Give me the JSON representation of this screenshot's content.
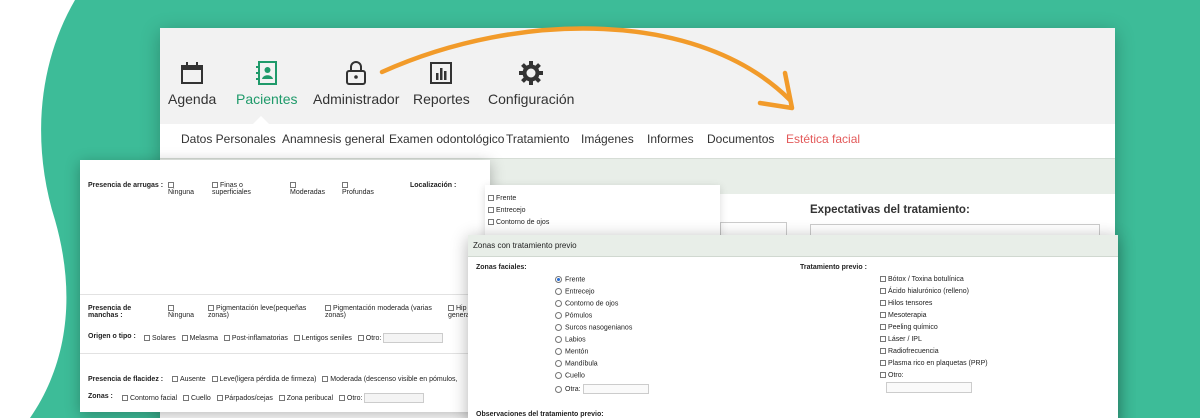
{
  "colors": {
    "background": "#3dbc98",
    "active_nav": "#1f9a6a",
    "active_tab": "#e35a5a",
    "arrow": "#f29b2a"
  },
  "nav": {
    "items": [
      {
        "label": "Agenda",
        "icon": "calendar-icon"
      },
      {
        "label": "Pacientes",
        "icon": "patients-book-icon",
        "active": true
      },
      {
        "label": "Administrador",
        "icon": "lock-icon"
      },
      {
        "label": "Reportes",
        "icon": "bar-chart-icon"
      },
      {
        "label": "Configuración",
        "icon": "gear-icon"
      }
    ]
  },
  "subtabs": [
    "Datos Personales",
    "Anamnesis general",
    "Examen odontológico",
    "Tratamiento",
    "Imágenes",
    "Informes",
    "Documentos",
    "Estética facial"
  ],
  "expectativas": {
    "title": "Expectativas del tratamiento:"
  },
  "arrugas": {
    "label": "Presencia de arrugas :",
    "options": [
      "Ninguna",
      "Finas o superficiales",
      "Moderadas",
      "Profundas"
    ],
    "localizacion_label": "Localización :"
  },
  "localizacion_list": [
    "Frente",
    "Entrecejo",
    "Contorno de ojos"
  ],
  "manchas": {
    "label": "Presencia de manchas :",
    "options": [
      "Ninguna",
      "Pigmentación leve(pequeñas zonas)",
      "Pigmentación moderada (varias zonas)",
      "Hip genera"
    ],
    "origen_label": "Origen o tipo :",
    "origen_options": [
      "Solares",
      "Melasma",
      "Post-inflamatorias",
      "Lentigos seniles",
      "Otro:"
    ]
  },
  "flacidez": {
    "label": "Presencia de flacidez :",
    "options": [
      "Ausente",
      "Leve(ligera pérdida de firmeza)",
      "Moderada (descenso visible en pómulos,"
    ],
    "zonas_label": "Zonas :",
    "zonas_options": [
      "Contorno facial",
      "Cuello",
      "Párpados/cejas",
      "Zona peribucal",
      "Otro:"
    ]
  },
  "zonas_previo": {
    "header": "Zonas con tratamiento previo",
    "zonas_label": "Zonas faciales:",
    "zonas": [
      "Frente",
      "Entrecejo",
      "Contorno de ojos",
      "Pómulos",
      "Surcos nasogenianos",
      "Labios",
      "Mentón",
      "Mandíbula",
      "Cuello",
      "Otra:"
    ],
    "selected": "Frente",
    "tratamiento_label": "Tratamiento previo :",
    "tratamientos": [
      "Bótox / Toxina botulínica",
      "Ácido hialurónico (relleno)",
      "Hilos tensores",
      "Mesoterapia",
      "Peeling químico",
      "Láser / IPL",
      "Radiofrecuencia",
      "Plasma rico en plaquetas (PRP)",
      "Otro:"
    ],
    "observaciones_label": "Observaciones del tratamiento previo:"
  }
}
